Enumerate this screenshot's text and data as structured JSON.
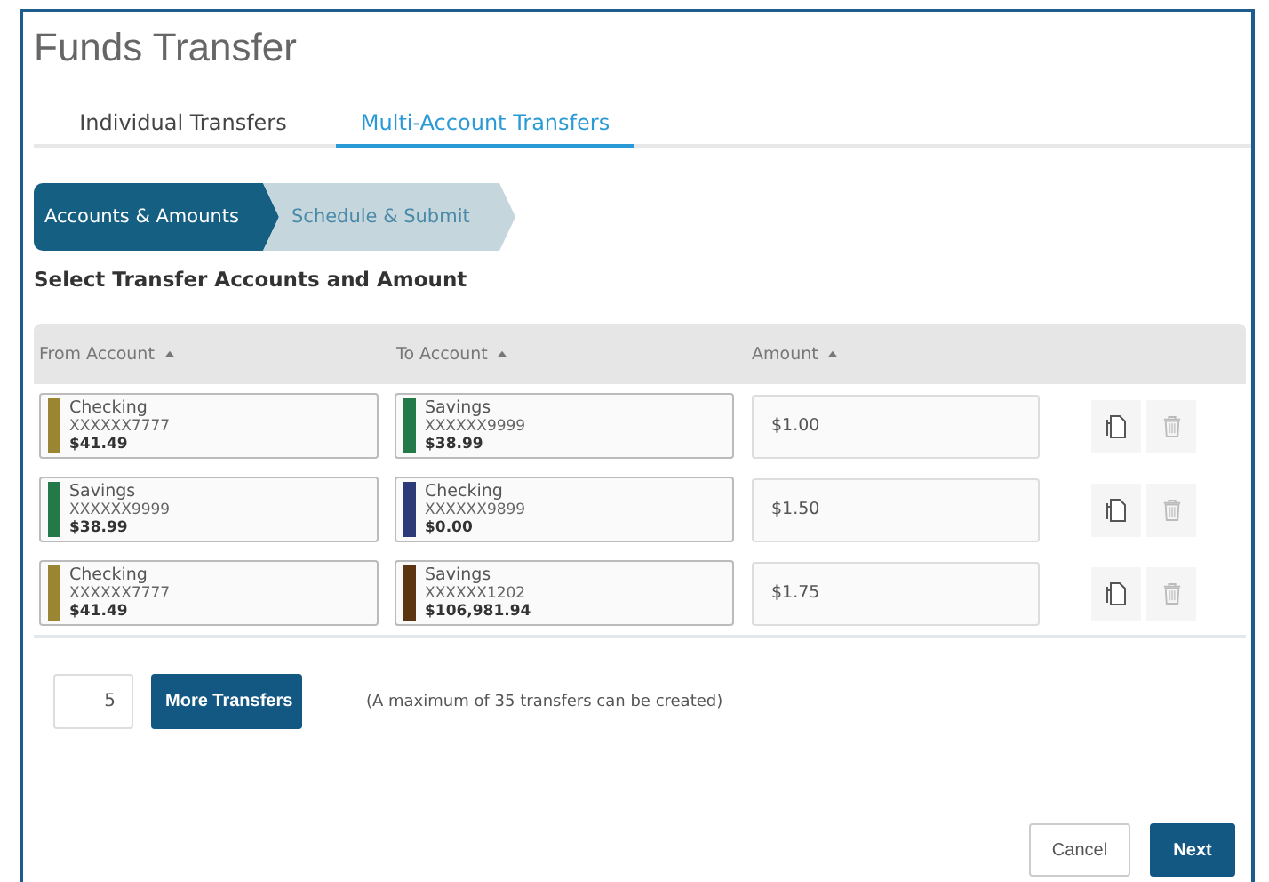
{
  "page": {
    "title": "Funds Transfer"
  },
  "tabs": [
    {
      "label": "Individual Transfers",
      "selected": false
    },
    {
      "label": "Multi-Account Transfers",
      "selected": true
    }
  ],
  "steps": [
    {
      "label": "Accounts & Amounts",
      "selected": true
    },
    {
      "label": "Schedule & Submit",
      "selected": false
    }
  ],
  "section_heading": "Select Transfer Accounts and Amount",
  "table": {
    "columns": [
      "From Account",
      "To Account",
      "Amount"
    ],
    "rows": [
      {
        "from": {
          "name": "Checking",
          "number": "XXXXXX7777",
          "balance": "$41.49",
          "color": "#9a8532"
        },
        "to": {
          "name": "Savings",
          "number": "XXXXXX9999",
          "balance": "$38.99",
          "color": "#237a48"
        },
        "amount": "$1.00"
      },
      {
        "from": {
          "name": "Savings",
          "number": "XXXXXX9999",
          "balance": "$38.99",
          "color": "#237a48"
        },
        "to": {
          "name": "Checking",
          "number": "XXXXXX9899",
          "balance": "$0.00",
          "color": "#2c3a78"
        },
        "amount": "$1.50"
      },
      {
        "from": {
          "name": "Checking",
          "number": "XXXXXX7777",
          "balance": "$41.49",
          "color": "#9a8532"
        },
        "to": {
          "name": "Savings",
          "number": "XXXXXX1202",
          "balance": "$106,981.94",
          "color": "#5c3410"
        },
        "amount": "$1.75"
      }
    ]
  },
  "more": {
    "count": "5",
    "button": "More Transfers",
    "note": "(A maximum of 35 transfers can be created)"
  },
  "buttons": [
    {
      "label": "Cancel",
      "kind": "secondary"
    },
    {
      "label": "Next",
      "kind": "primary"
    }
  ]
}
